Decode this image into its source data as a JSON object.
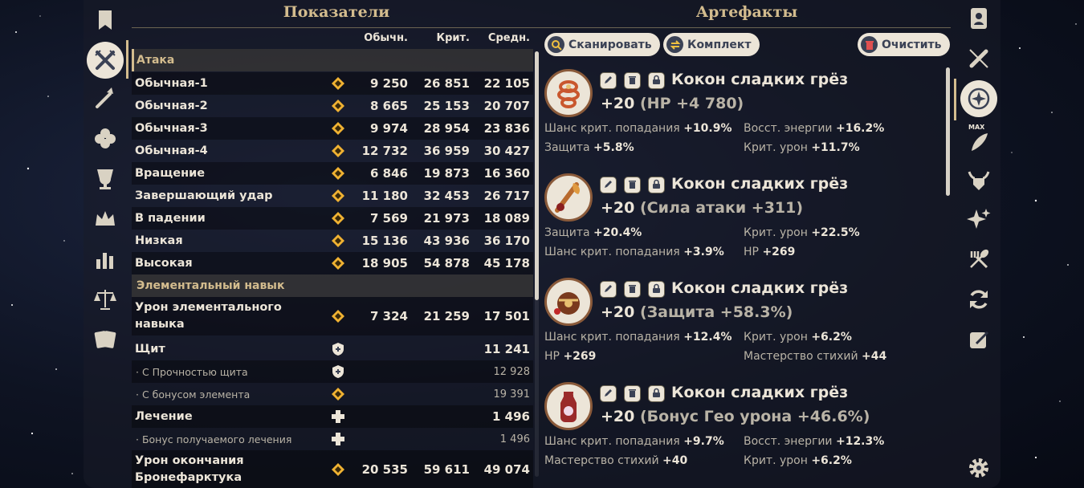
{
  "stats_panel": {
    "title": "Показатели",
    "columns": [
      "Обычн.",
      "Крит.",
      "Средн."
    ],
    "sections": {
      "attack": "Атака",
      "skill": "Элементальный навык"
    },
    "attack_rows": [
      {
        "label": "Обычная-1",
        "normal": "9 250",
        "crit": "26 851",
        "avg": "22 105"
      },
      {
        "label": "Обычная-2",
        "normal": "8 665",
        "crit": "25 153",
        "avg": "20 707"
      },
      {
        "label": "Обычная-3",
        "normal": "9 974",
        "crit": "28 954",
        "avg": "23 836"
      },
      {
        "label": "Обычная-4",
        "normal": "12 732",
        "crit": "36 959",
        "avg": "30 427"
      },
      {
        "label": "Вращение",
        "normal": "6 846",
        "crit": "19 873",
        "avg": "16 360"
      },
      {
        "label": "Завершающий удар",
        "normal": "11 180",
        "crit": "32 453",
        "avg": "26 717"
      },
      {
        "label": "В падении",
        "normal": "7 569",
        "crit": "21 973",
        "avg": "18 089"
      },
      {
        "label": "Низкая",
        "normal": "15 136",
        "crit": "43 936",
        "avg": "36 170"
      },
      {
        "label": "Высокая",
        "normal": "18 905",
        "crit": "54 878",
        "avg": "45 178"
      }
    ],
    "skill_rows": {
      "skill_dmg": {
        "label": "Урон элементального навыка",
        "normal": "7 324",
        "crit": "21 259",
        "avg": "17 501"
      },
      "shield": {
        "label": "Щит",
        "avg": "11 241"
      },
      "shield_strength": {
        "label": "· С Прочностью щита",
        "avg": "12 928"
      },
      "shield_element": {
        "label": "· С бонусом элемента",
        "avg": "19 391"
      },
      "healing": {
        "label": "Лечение",
        "avg": "1 496"
      },
      "healing_bonus": {
        "label": "· Бонус получаемого лечения",
        "avg": "1 496"
      },
      "armor_end": {
        "label": "Урон окончания Бронефарктука",
        "normal": "20 535",
        "crit": "59 611",
        "avg": "49 074"
      }
    }
  },
  "artifacts_panel": {
    "title": "Артефакты",
    "buttons": {
      "scan": "Сканировать",
      "set": "Комплект",
      "clear": "Очистить"
    },
    "items": [
      {
        "name": "Кокон сладких грёз",
        "level": "+20",
        "main_stat": "(HP +4 780)",
        "subs": [
          {
            "name": "Шанс крит. попадания",
            "value": "+10.9%"
          },
          {
            "name": "Восст. энергии",
            "value": "+16.2%"
          },
          {
            "name": "Защита",
            "value": "+5.8%"
          },
          {
            "name": "Крит. урон",
            "value": "+11.7%"
          }
        ]
      },
      {
        "name": "Кокон сладких грёз",
        "level": "+20",
        "main_stat": "(Сила атаки +311)",
        "subs": [
          {
            "name": "Защита",
            "value": "+20.4%"
          },
          {
            "name": "Крит. урон",
            "value": "+22.5%"
          },
          {
            "name": "Шанс крит. попадания",
            "value": "+3.9%"
          },
          {
            "name": "HP",
            "value": "+269"
          }
        ]
      },
      {
        "name": "Кокон сладких грёз",
        "level": "+20",
        "main_stat": "(Защита +58.3%)",
        "subs": [
          {
            "name": "Шанс крит. попадания",
            "value": "+12.4%"
          },
          {
            "name": "Крит. урон",
            "value": "+6.2%"
          },
          {
            "name": "HP",
            "value": "+269"
          },
          {
            "name": "Мастерство стихий",
            "value": "+44"
          }
        ]
      },
      {
        "name": "Кокон сладких грёз",
        "level": "+20",
        "main_stat": "(Бонус Гео урона +46.6%)",
        "subs": [
          {
            "name": "Шанс крит. попадания",
            "value": "+9.7%"
          },
          {
            "name": "Восст. энергии",
            "value": "+12.3%"
          },
          {
            "name": "Мастерство стихий",
            "value": "+40"
          },
          {
            "name": "Крит. урон",
            "value": "+6.2%"
          }
        ]
      }
    ]
  },
  "right_rail": {
    "max_label": "MAX"
  },
  "colors": {
    "accent": "#d3bc8e",
    "text": "#ece5d8",
    "geo": "#f0b232",
    "panel_dark": "#3b4255"
  }
}
